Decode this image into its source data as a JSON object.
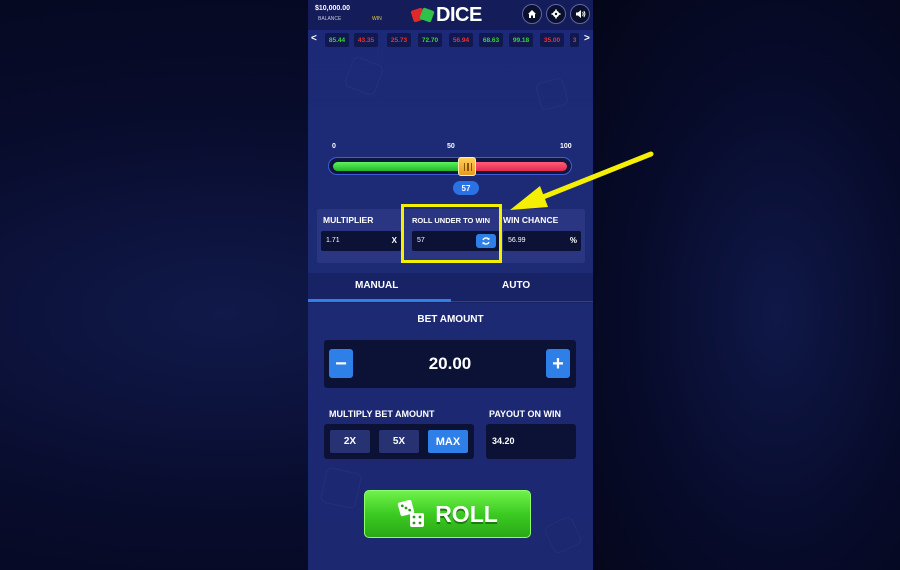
{
  "topbar": {
    "balance_value": "$10,000.00",
    "balance_label": "BALANCE",
    "win_label": "WIN",
    "logo_text": "DICE",
    "icons": [
      "home-icon",
      "gear-icon",
      "speaker-icon"
    ]
  },
  "history": {
    "prev_arrow": "<",
    "next_arrow": ">",
    "results": [
      {
        "value": "85.44",
        "color": "green"
      },
      {
        "value": "43.35",
        "color": "red"
      },
      {
        "value": "25.73",
        "color": "red"
      },
      {
        "value": "72.70",
        "color": "green"
      },
      {
        "value": "56.94",
        "color": "red"
      },
      {
        "value": "68.63",
        "color": "green"
      },
      {
        "value": "99.18",
        "color": "green"
      },
      {
        "value": "35.00",
        "color": "red"
      },
      {
        "value": "3",
        "color": "red"
      }
    ]
  },
  "slider": {
    "tick_min": "0",
    "tick_mid": "50",
    "tick_max": "100",
    "value": "57"
  },
  "stats": {
    "multiplier_label": "MULTIPLIER",
    "multiplier_value": "1.71",
    "multiplier_unit": "X",
    "roll_under_label": "ROLL UNDER TO WIN",
    "roll_under_value": "57",
    "win_chance_label": "WIN CHANCE",
    "win_chance_value": "56.99",
    "win_chance_unit": "%"
  },
  "tabs": {
    "manual": "MANUAL",
    "auto": "AUTO",
    "active": "manual"
  },
  "bet": {
    "title": "BET AMOUNT",
    "minus": "−",
    "plus": "+",
    "value": "20.00"
  },
  "multiply": {
    "label": "MULTIPLY BET AMOUNT",
    "options": [
      "2X",
      "5X",
      "MAX"
    ]
  },
  "payout": {
    "label": "PAYOUT ON WIN",
    "value": "34.20"
  },
  "roll_button": "ROLL",
  "colors": {
    "accent_blue": "#2f7fe8",
    "win_green": "#39d23a",
    "lose_red": "#e83232",
    "highlight_yellow": "#f5f003"
  }
}
